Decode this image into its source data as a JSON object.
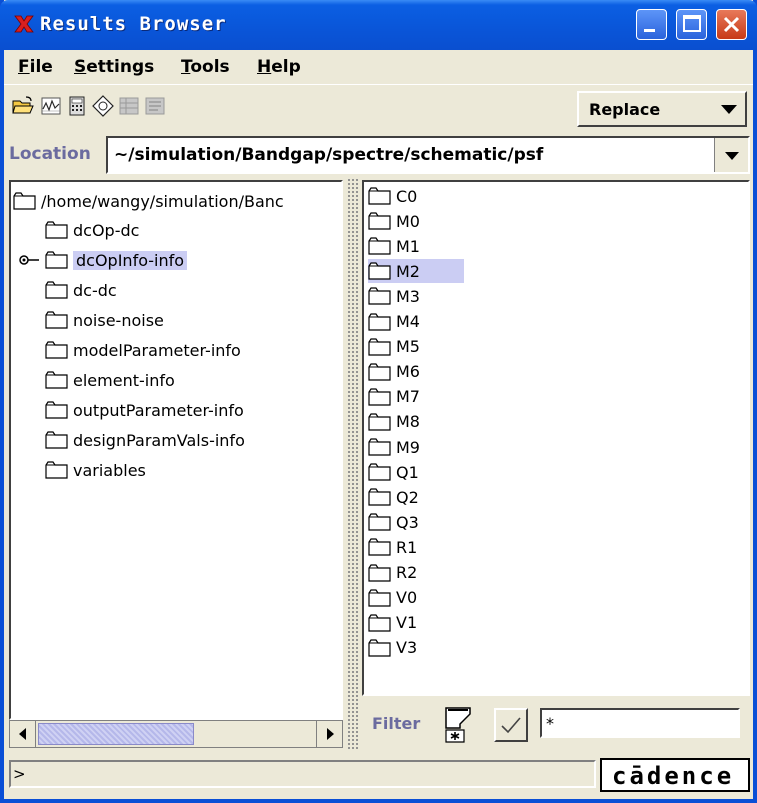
{
  "window": {
    "title": "Results Browser"
  },
  "menubar": {
    "items": [
      {
        "label": "File",
        "hotkey": "F",
        "rest": "ile"
      },
      {
        "label": "Settings",
        "hotkey": "S",
        "rest": "ettings"
      },
      {
        "label": "Tools",
        "hotkey": "T",
        "rest": "ools"
      },
      {
        "label": "Help",
        "hotkey": "H",
        "rest": "elp"
      }
    ]
  },
  "toolbar": {
    "icons": [
      "open-folder-icon",
      "waveform-icon",
      "calculator-icon",
      "diamond-nav-icon",
      "table-icon",
      "list-icon"
    ],
    "mode_select": {
      "value": "Replace"
    }
  },
  "location": {
    "label": "Location",
    "value": "~/simulation/Bandgap/spectre/schematic/psf"
  },
  "tree": {
    "root": "/home/wangy/simulation/Banc",
    "items": [
      {
        "label": "dcOp-dc",
        "selected": false
      },
      {
        "label": "dcOpInfo-info",
        "selected": true
      },
      {
        "label": "dc-dc",
        "selected": false
      },
      {
        "label": "noise-noise",
        "selected": false
      },
      {
        "label": "modelParameter-info",
        "selected": false
      },
      {
        "label": "element-info",
        "selected": false
      },
      {
        "label": "outputParameter-info",
        "selected": false
      },
      {
        "label": "designParamVals-info",
        "selected": false
      },
      {
        "label": "variables",
        "selected": false
      }
    ]
  },
  "list": {
    "items": [
      "C0",
      "M0",
      "M1",
      "M2",
      "M3",
      "M4",
      "M5",
      "M6",
      "M7",
      "M8",
      "M9",
      "Q1",
      "Q2",
      "Q3",
      "R1",
      "R2",
      "V0",
      "V1",
      "V3"
    ],
    "selected": "M2"
  },
  "filter": {
    "label": "Filter",
    "value": "*"
  },
  "status": {
    "prompt": ">"
  },
  "brand": {
    "logo": "cādence"
  },
  "colors": {
    "selection": "#cbcdf3",
    "title_bar": "#0a55d8",
    "label_accent": "#6b6b9f"
  }
}
